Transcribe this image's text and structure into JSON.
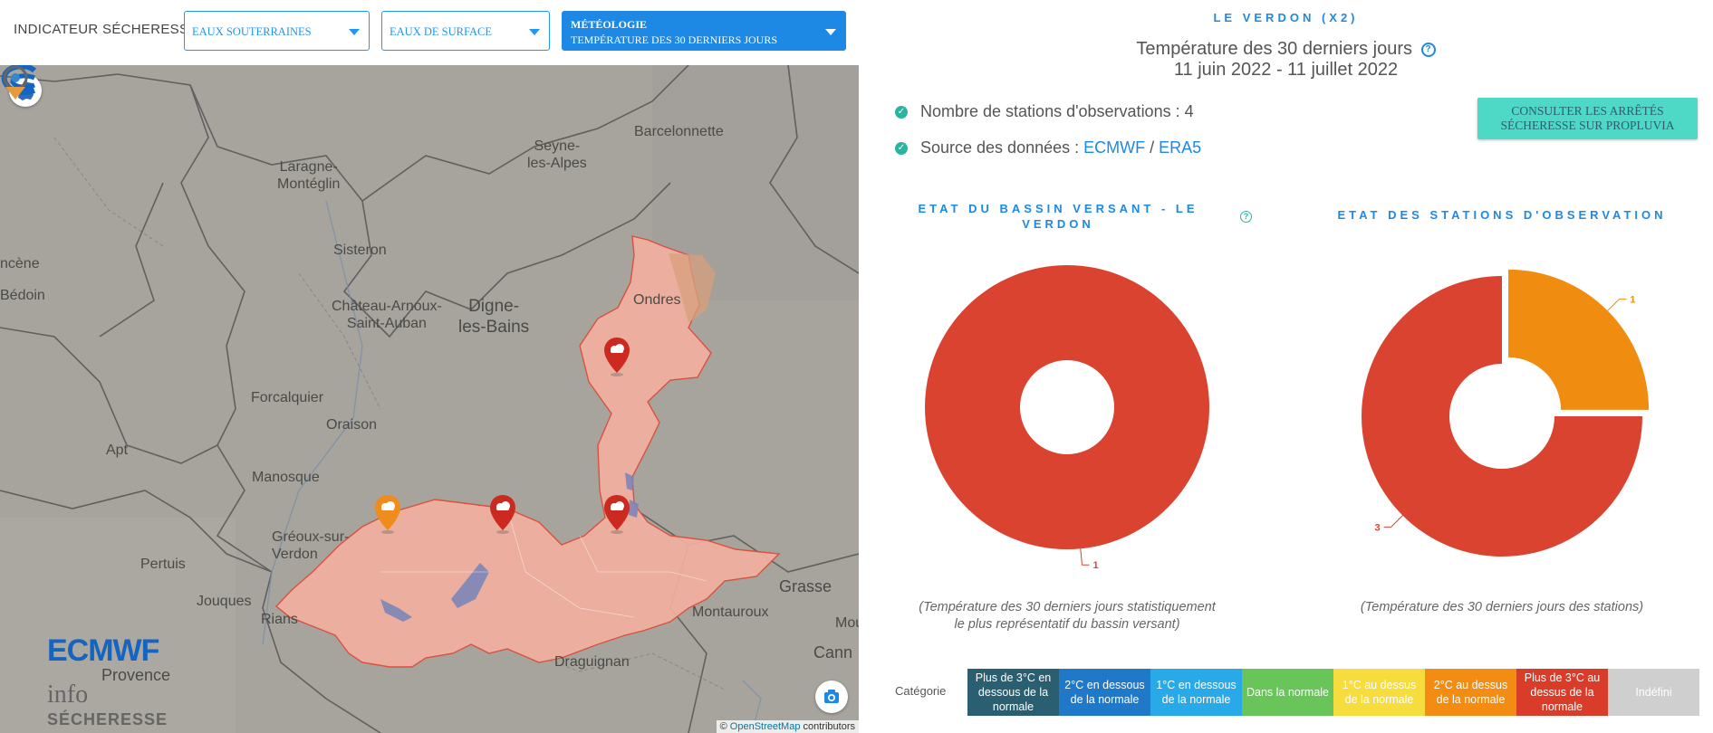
{
  "toolbar": {
    "indicator_label": "INDICATEUR SÉCHERESSE :",
    "selector_groundwater": "EAUX SOUTERRAINES",
    "selector_surface": "EAUX DE SURFACE",
    "selector_meteo_title": "MÉTÉOLOGIE",
    "selector_meteo_sub": "TEMPÉRATURE DES 30 DERNIERS JOURS"
  },
  "map": {
    "places": {
      "barcelonnette": "Barcelonnette",
      "seyne": "Seyne-\nles-Alpes",
      "laragne": "Laragne-\nMontéglin",
      "sisteron": "Sisteron",
      "chateau_arnoux": "Château-Arnoux-\nSaint-Auban",
      "digne": "Digne-\nles-Bains",
      "ondres": "Ondres",
      "forcalquier": "Forcalquier",
      "oraison": "Oraison",
      "apt": "Apt",
      "manosque": "Manosque",
      "gréoux": "Gréoux-sur-\nVerdon",
      "pertuis": "Pertuis",
      "jouques": "Jouques",
      "rians": "Rians",
      "provence": "Provence",
      "draguignan": "Draguignan",
      "montauroux": "Montauroux",
      "grasse": "Grasse",
      "mougins": "Mougin",
      "cannes": "Cann",
      "bedoin": "Bédoin",
      "mazan": "ncène"
    },
    "logo_ecmwf": "ECMWF",
    "logo_info": "info",
    "logo_secheresse": "SÉCHERESSE",
    "attribution_prefix": "©",
    "attribution_link": "OpenStreetMap",
    "attribution_suffix": "contributors",
    "colors": {
      "basin_fill": "#f4b0a0",
      "basin_stroke": "#d9513f",
      "marker_red": "#cc2a20",
      "marker_orange": "#f08c1c"
    }
  },
  "panel": {
    "basin_title": "LE VERDON (X2)",
    "title": "Température des 30 derniers jours",
    "help_icon": "?",
    "date_range": "11 juin 2022 - 11 juillet 2022",
    "stations_label": "Nombre de stations d'observations : 4",
    "source_label": "Source des données :",
    "source_link_1": "ECMWF",
    "source_sep": "/",
    "source_link_2": "ERA5",
    "propluvia_button": "CONSULTER LES ARRÊTÉS SÉCHERESSE SUR PROPLUVIA",
    "chart1_title": "ETAT DU BASSIN VERSANT - LE VERDON",
    "chart2_title": "ETAT DES STATIONS D'OBSERVATION",
    "chart1_caption": "(Température des 30 derniers jours statistiquement le plus représentatif du bassin versant)",
    "chart2_caption": "(Température des 30 derniers jours des stations)"
  },
  "chart_data": [
    {
      "type": "pie",
      "title": "ETAT DU BASSIN VERSANT - LE VERDON",
      "categories": [
        "Plus de 3°C au dessus de la normale"
      ],
      "values": [
        1
      ],
      "colors": [
        "#da4330"
      ]
    },
    {
      "type": "pie",
      "title": "ETAT DES STATIONS D'OBSERVATION",
      "categories": [
        "2°C au dessus de la normale",
        "Plus de 3°C au dessus de la normale"
      ],
      "values": [
        1,
        3
      ],
      "colors": [
        "#f08c10",
        "#da4330"
      ]
    }
  ],
  "legend": {
    "label": "Catégorie",
    "items": [
      {
        "label": "Plus de 3°C en dessous de la normale",
        "color": "#2a5f72",
        "text_color": "#ffffff"
      },
      {
        "label": "2°C en dessous de la normale",
        "color": "#1f78c8",
        "text_color": "#ffffff"
      },
      {
        "label": "1°C en dessous de la normale",
        "color": "#29a9e8",
        "text_color": "#ffffff"
      },
      {
        "label": "Dans la normale",
        "color": "#69c45a",
        "text_color": "#ffffff"
      },
      {
        "label": "1°C au dessus de la normale",
        "color": "#f6dc3c",
        "text_color": "#ffffff"
      },
      {
        "label": "2°C au dessus de la normale",
        "color": "#f28c12",
        "text_color": "#ffffff"
      },
      {
        "label": "Plus de 3°C au dessus de la normale",
        "color": "#da3c2a",
        "text_color": "#ffffff"
      },
      {
        "label": "Indéfini",
        "color": "#cfcfcf",
        "text_color": "#ffffff"
      }
    ]
  }
}
